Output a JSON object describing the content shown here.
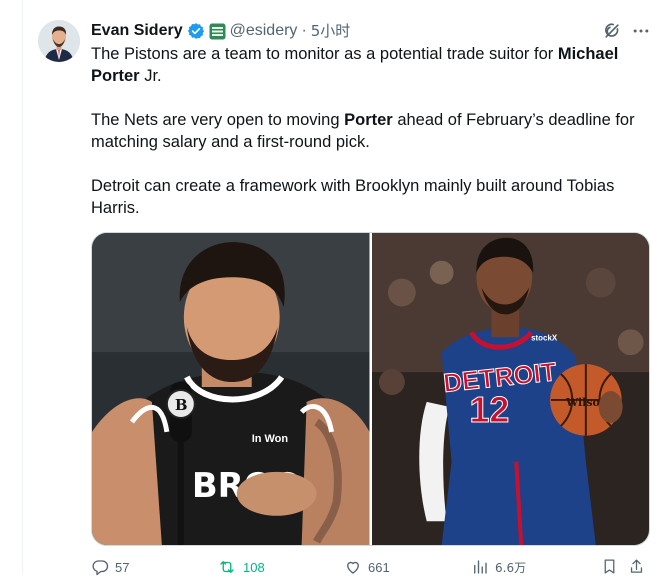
{
  "author": {
    "display_name": "Evan Sidery",
    "handle": "@esidery",
    "separator": "·",
    "time": "5小时"
  },
  "tweet": {
    "p1_before": "The Pistons are a team to monitor as a potential trade suitor for ",
    "p1_bold1": "Michael Porter",
    "p1_after": " Jr.",
    "p2_before": "The Nets are very open to moving ",
    "p2_bold": "Porter",
    "p2_after": " ahead of February’s deadline for matching salary and a first-round pick.",
    "p3": "Detroit can create a framework with Brooklyn mainly built around Tobias Harris."
  },
  "media": {
    "left_mic_letter": "B",
    "left_jersey_text": "BROO",
    "left_sponsor": "In Won",
    "right_jersey_city": "DETROIT",
    "right_jersey_number": "12",
    "right_jersey_sponsor": "stockX",
    "right_ball_text": "Wilson"
  },
  "actions": {
    "replies": "57",
    "retweets": "108",
    "likes": "661",
    "views": "6.6万"
  },
  "colors": {
    "text_primary": "#0f1419",
    "text_secondary": "#536471",
    "verified": "#1d9bf0",
    "retweet_active": "#00ba7c",
    "affiliate_badge": "#2e8b57"
  }
}
